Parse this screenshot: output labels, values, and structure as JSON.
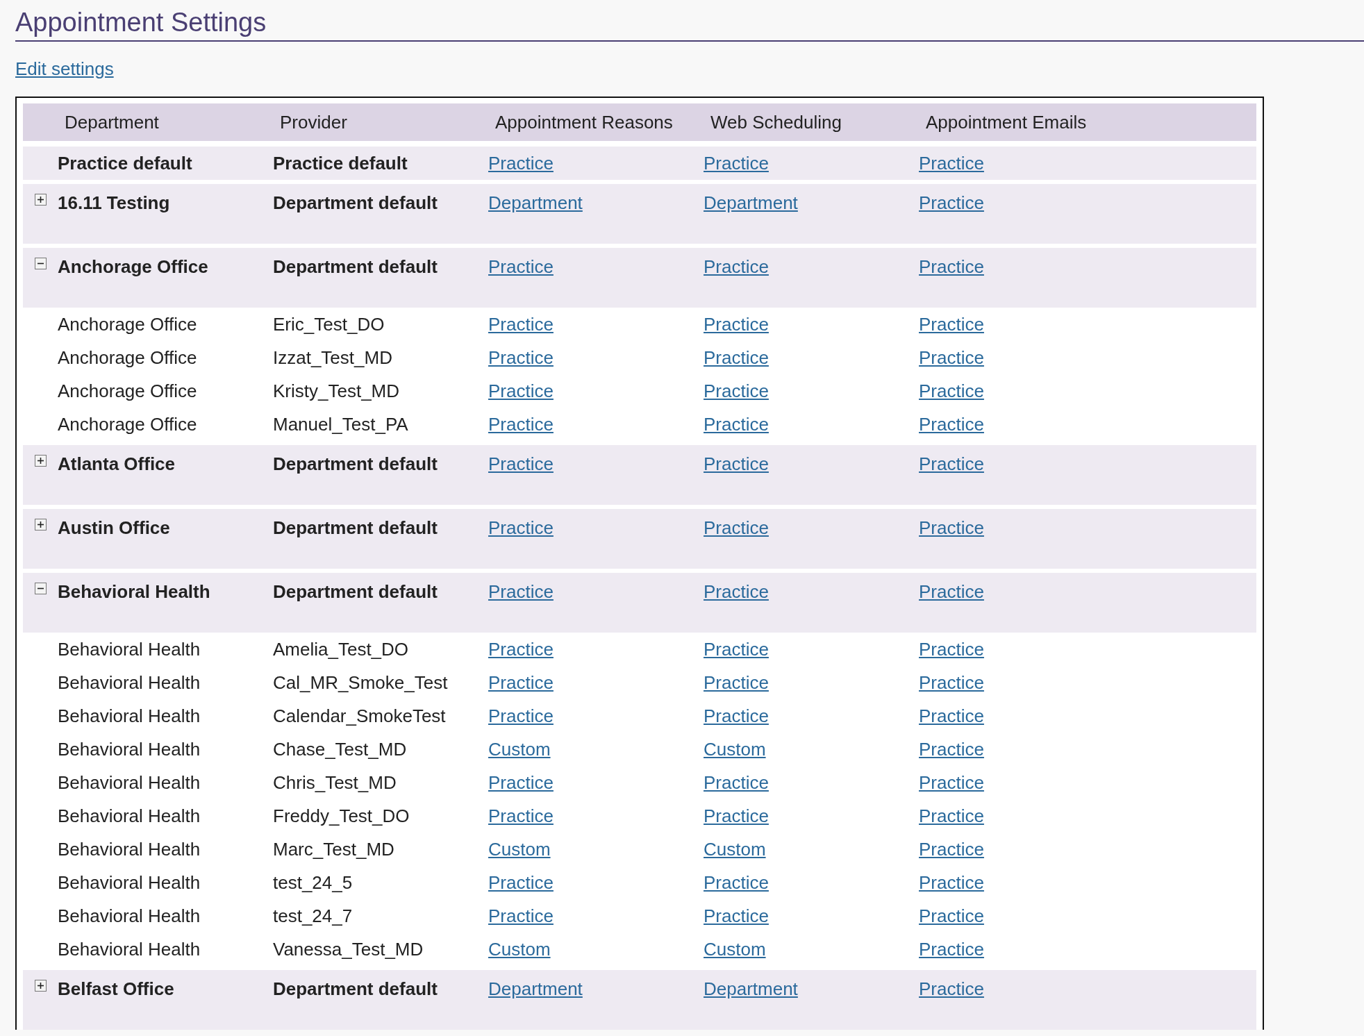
{
  "page_title": "Appointment Settings",
  "edit_link": "Edit settings",
  "table": {
    "columns": [
      "Department",
      "Provider",
      "Appointment Reasons",
      "Web Scheduling",
      "Appointment Emails"
    ],
    "rows": [
      {
        "kind": "default",
        "department": "Practice default",
        "provider": "Practice default",
        "reasons": "Practice",
        "web": "Practice",
        "emails": "Practice"
      },
      {
        "kind": "department",
        "expanded": false,
        "department": "16.11 Testing",
        "provider": "Department default",
        "reasons": "Department",
        "web": "Department",
        "emails": "Practice"
      },
      {
        "kind": "department",
        "expanded": true,
        "department": "Anchorage Office",
        "provider": "Department default",
        "reasons": "Practice",
        "web": "Practice",
        "emails": "Practice",
        "children": [
          {
            "department": "Anchorage Office",
            "provider": "Eric_Test_DO",
            "reasons": "Practice",
            "web": "Practice",
            "emails": "Practice"
          },
          {
            "department": "Anchorage Office",
            "provider": "Izzat_Test_MD",
            "reasons": "Practice",
            "web": "Practice",
            "emails": "Practice"
          },
          {
            "department": "Anchorage Office",
            "provider": "Kristy_Test_MD",
            "reasons": "Practice",
            "web": "Practice",
            "emails": "Practice"
          },
          {
            "department": "Anchorage Office",
            "provider": "Manuel_Test_PA",
            "reasons": "Practice",
            "web": "Practice",
            "emails": "Practice"
          }
        ]
      },
      {
        "kind": "department",
        "expanded": false,
        "department": "Atlanta Office",
        "provider": "Department default",
        "reasons": "Practice",
        "web": "Practice",
        "emails": "Practice"
      },
      {
        "kind": "department",
        "expanded": false,
        "department": "Austin Office",
        "provider": "Department default",
        "reasons": "Practice",
        "web": "Practice",
        "emails": "Practice"
      },
      {
        "kind": "department",
        "expanded": true,
        "department": "Behavioral Health",
        "provider": "Department default",
        "reasons": "Practice",
        "web": "Practice",
        "emails": "Practice",
        "children": [
          {
            "department": "Behavioral Health",
            "provider": "Amelia_Test_DO",
            "reasons": "Practice",
            "web": "Practice",
            "emails": "Practice"
          },
          {
            "department": "Behavioral Health",
            "provider": "Cal_MR_Smoke_Test",
            "reasons": "Practice",
            "web": "Practice",
            "emails": "Practice"
          },
          {
            "department": "Behavioral Health",
            "provider": "Calendar_SmokeTest",
            "reasons": "Practice",
            "web": "Practice",
            "emails": "Practice"
          },
          {
            "department": "Behavioral Health",
            "provider": "Chase_Test_MD",
            "reasons": "Custom",
            "web": "Custom",
            "emails": "Practice"
          },
          {
            "department": "Behavioral Health",
            "provider": "Chris_Test_MD",
            "reasons": "Practice",
            "web": "Practice",
            "emails": "Practice"
          },
          {
            "department": "Behavioral Health",
            "provider": "Freddy_Test_DO",
            "reasons": "Practice",
            "web": "Practice",
            "emails": "Practice"
          },
          {
            "department": "Behavioral Health",
            "provider": "Marc_Test_MD",
            "reasons": "Custom",
            "web": "Custom",
            "emails": "Practice"
          },
          {
            "department": "Behavioral Health",
            "provider": "test_24_5",
            "reasons": "Practice",
            "web": "Practice",
            "emails": "Practice"
          },
          {
            "department": "Behavioral Health",
            "provider": "test_24_7",
            "reasons": "Practice",
            "web": "Practice",
            "emails": "Practice"
          },
          {
            "department": "Behavioral Health",
            "provider": "Vanessa_Test_MD",
            "reasons": "Custom",
            "web": "Custom",
            "emails": "Practice"
          }
        ]
      },
      {
        "kind": "department",
        "expanded": false,
        "department": "Belfast Office",
        "provider": "Department default",
        "reasons": "Department",
        "web": "Department",
        "emails": "Practice"
      }
    ]
  }
}
